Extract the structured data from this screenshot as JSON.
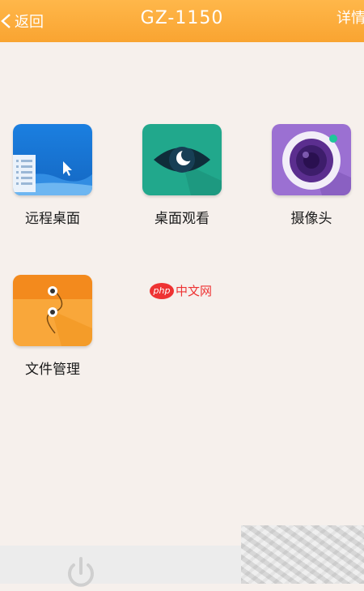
{
  "header": {
    "back_label": "返回",
    "title": "GZ-1150",
    "detail_label": "详情"
  },
  "apps": [
    {
      "label": "远程桌面",
      "icon": "remote-desktop-icon"
    },
    {
      "label": "桌面观看",
      "icon": "eye-moon-icon"
    },
    {
      "label": "摄像头",
      "icon": "camera-lens-icon"
    },
    {
      "label": "文件管理",
      "icon": "folder-envelope-icon"
    }
  ],
  "watermark": {
    "badge": "php",
    "text": "中文网"
  },
  "bottom": {
    "power_icon": "power-icon"
  },
  "colors": {
    "header": "#f9a431",
    "background": "#f6f0ec",
    "remote_desktop": "#1a78d6",
    "desktop_view": "#1ea68a",
    "camera": "#9a6fd0",
    "file_manager": "#f7a234"
  }
}
